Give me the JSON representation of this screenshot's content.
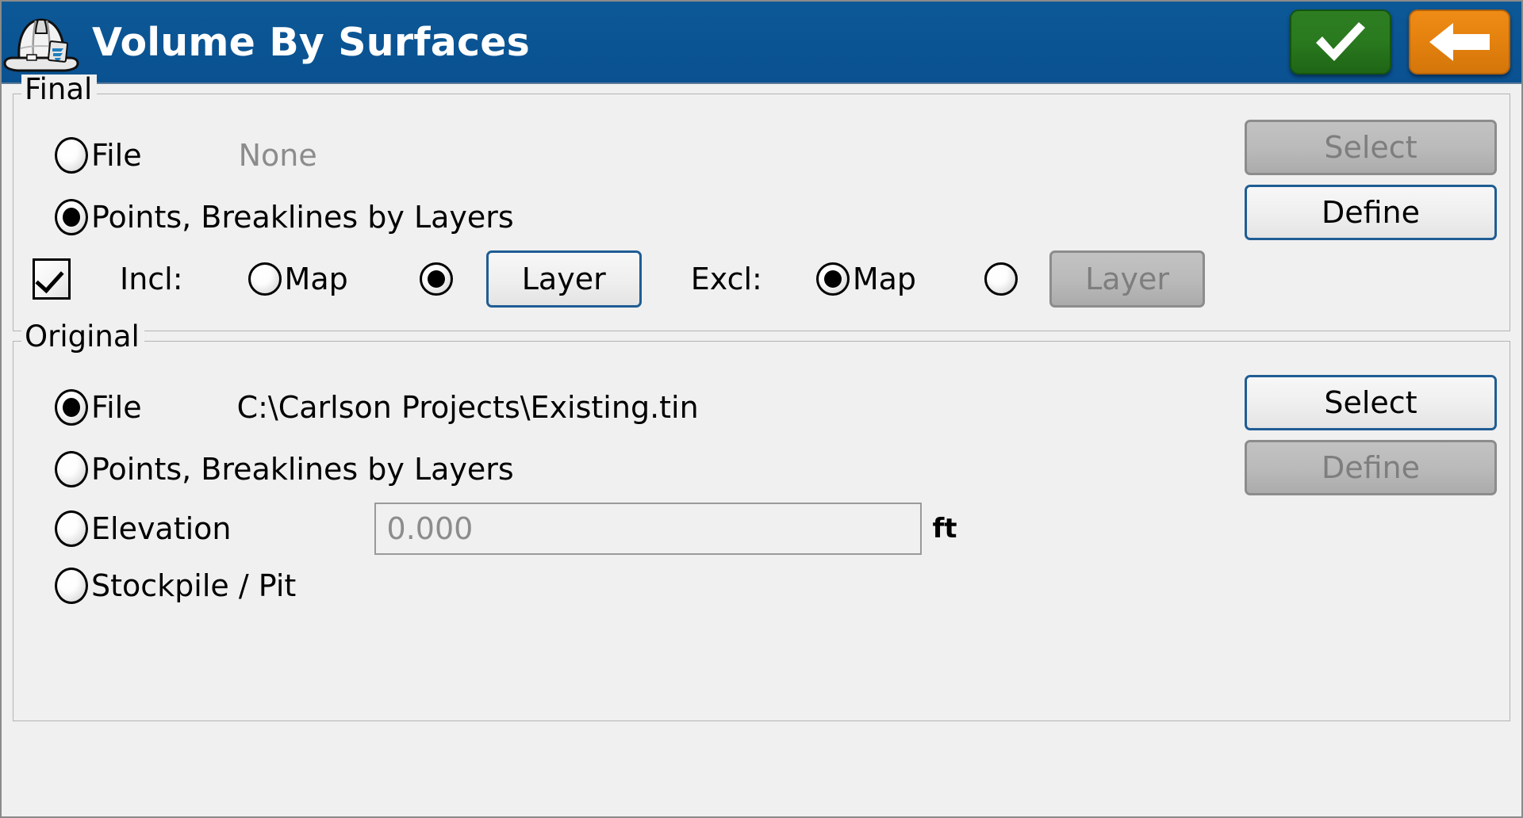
{
  "window": {
    "title": "Volume By Surfaces",
    "icon": "hardhat-icon",
    "accent_bar_color": "#0b5394",
    "ok_button_color": "#2a7a1f",
    "back_button_color": "#e5820f",
    "ok_icon": "checkmark-icon",
    "back_icon": "left-arrow-icon"
  },
  "final": {
    "legend": "Final",
    "file": {
      "label": "File",
      "selected": false,
      "value": "None",
      "value_muted": true,
      "select_button": {
        "label": "Select",
        "enabled": false
      }
    },
    "points_breaklines": {
      "label": "Points, Breaklines by Layers",
      "selected": true,
      "define_button": {
        "label": "Define",
        "enabled": true
      }
    },
    "filter": {
      "checkbox_checked": true,
      "incl_label": "Incl:",
      "incl_map": {
        "label": "Map",
        "selected": false
      },
      "incl_layer_radio_selected": true,
      "incl_layer_button": {
        "label": "Layer",
        "enabled": true
      },
      "excl_label": "Excl:",
      "excl_map": {
        "label": "Map",
        "selected": true
      },
      "excl_layer_radio_selected": false,
      "excl_layer_button": {
        "label": "Layer",
        "enabled": false
      }
    }
  },
  "original": {
    "legend": "Original",
    "file": {
      "label": "File",
      "selected": true,
      "value": "C:\\Carlson Projects\\Existing.tin",
      "value_muted": false,
      "select_button": {
        "label": "Select",
        "enabled": true
      }
    },
    "points_breaklines": {
      "label": "Points, Breaklines by Layers",
      "selected": false,
      "define_button": {
        "label": "Define",
        "enabled": false
      }
    },
    "elevation": {
      "label": "Elevation",
      "selected": false,
      "value": "0.000",
      "unit": "ft"
    },
    "stockpile_pit": {
      "label": "Stockpile / Pit",
      "selected": false
    }
  }
}
